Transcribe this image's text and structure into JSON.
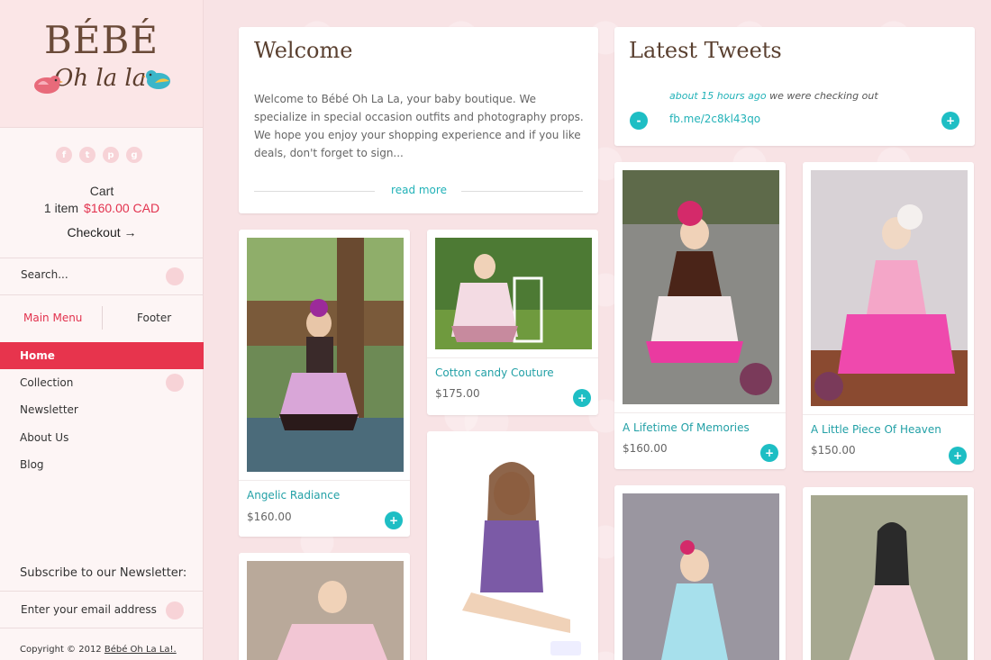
{
  "brand": {
    "name": "BÉBÉ",
    "tagline": "Oh la la"
  },
  "social_icons": [
    "facebook-icon",
    "twitter-icon",
    "pinterest-icon",
    "google-plus-icon"
  ],
  "cart": {
    "title": "Cart",
    "count": "1 item",
    "total": "$160.00 CAD",
    "checkout": "Checkout →"
  },
  "search": {
    "placeholder": "Search..."
  },
  "menu_tabs": {
    "main": "Main Menu",
    "footer": "Footer"
  },
  "nav": [
    {
      "label": "Home",
      "active": true
    },
    {
      "label": "Collection"
    },
    {
      "label": "Newsletter"
    },
    {
      "label": "About Us"
    },
    {
      "label": "Blog"
    }
  ],
  "newsletter": {
    "title": "Subscribe to our Newsletter:",
    "placeholder": "Enter your email address"
  },
  "footer": {
    "copyright": "Copyright © 2012",
    "link": "Bébé Oh La La!."
  },
  "welcome": {
    "title": "Welcome",
    "body": "Welcome to Bébé Oh La La, your baby boutique. We specialize in special occasion outfits and photography props. We hope you enjoy your shopping experience and if you like deals, don't forget to sign...",
    "read_more": "read more"
  },
  "tweets": {
    "title": "Latest Tweets",
    "time": "about 15 hours ago",
    "text": " we were checking out",
    "link": "fb.me/2c8kl43qo"
  },
  "products": [
    {
      "name": "Angelic Radiance",
      "price": "$160.00"
    },
    {
      "name": "Cotton candy Couture",
      "price": "$175.00"
    },
    {
      "name": "A Lifetime Of Memories",
      "price": "$160.00"
    },
    {
      "name": "A Little Piece Of Heaven",
      "price": "$150.00"
    }
  ],
  "colors": {
    "accent": "#e7344d",
    "teal": "#1ebec4",
    "brown": "#5a4030"
  }
}
